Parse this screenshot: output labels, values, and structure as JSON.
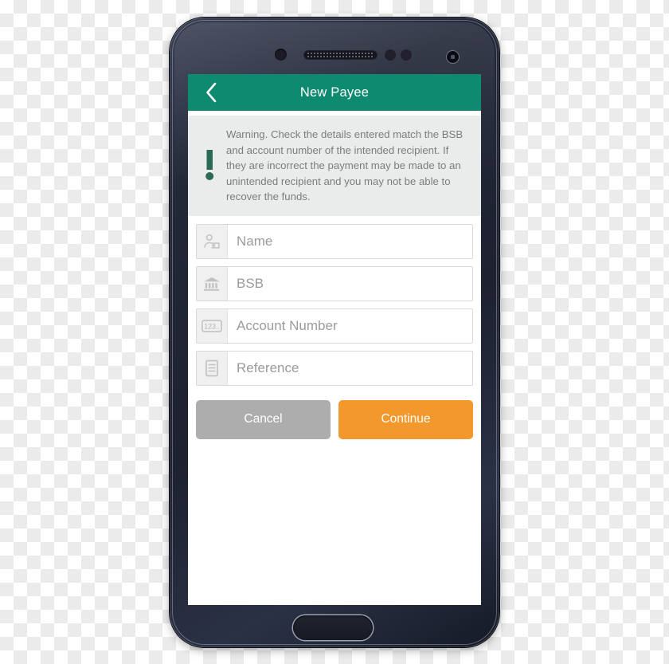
{
  "device": {
    "name": "smartphone-mockup",
    "hardware": {
      "earpiece": "earpiece-speaker",
      "front_camera": "front-camera-icon",
      "proximity_sensor": "sensor-dot",
      "home_button": "home-button"
    }
  },
  "colors": {
    "header_teal": "#0D8A6F",
    "continue_orange": "#F2982C",
    "cancel_gray": "#ADADAD",
    "warning_panel_bg": "#EAECEB",
    "warning_icon_green": "#2B6B55",
    "placeholder_text": "#9B9B9B",
    "phone_body": "#232838"
  },
  "header": {
    "title": "New Payee",
    "back_icon": "chevron-left-icon",
    "back_label": "Back"
  },
  "warning": {
    "icon": "exclamation-mark-icon",
    "text": "Warning. Check the details entered match the BSB and account number of the intended recipient. If they are incorrect the payment may be made to an unintended recipient and you may not be able to recover the funds."
  },
  "form": {
    "fields": [
      {
        "key": "name",
        "placeholder": "Name",
        "value": "",
        "icon": "person-tag-icon"
      },
      {
        "key": "bsb",
        "placeholder": "BSB",
        "value": "",
        "icon": "bank-building-icon"
      },
      {
        "key": "account_number",
        "placeholder": "Account Number",
        "value": "",
        "icon": "numeric-123-icon"
      },
      {
        "key": "reference",
        "placeholder": "Reference",
        "value": "",
        "icon": "document-lines-icon"
      }
    ]
  },
  "actions": {
    "cancel_label": "Cancel",
    "continue_label": "Continue"
  }
}
